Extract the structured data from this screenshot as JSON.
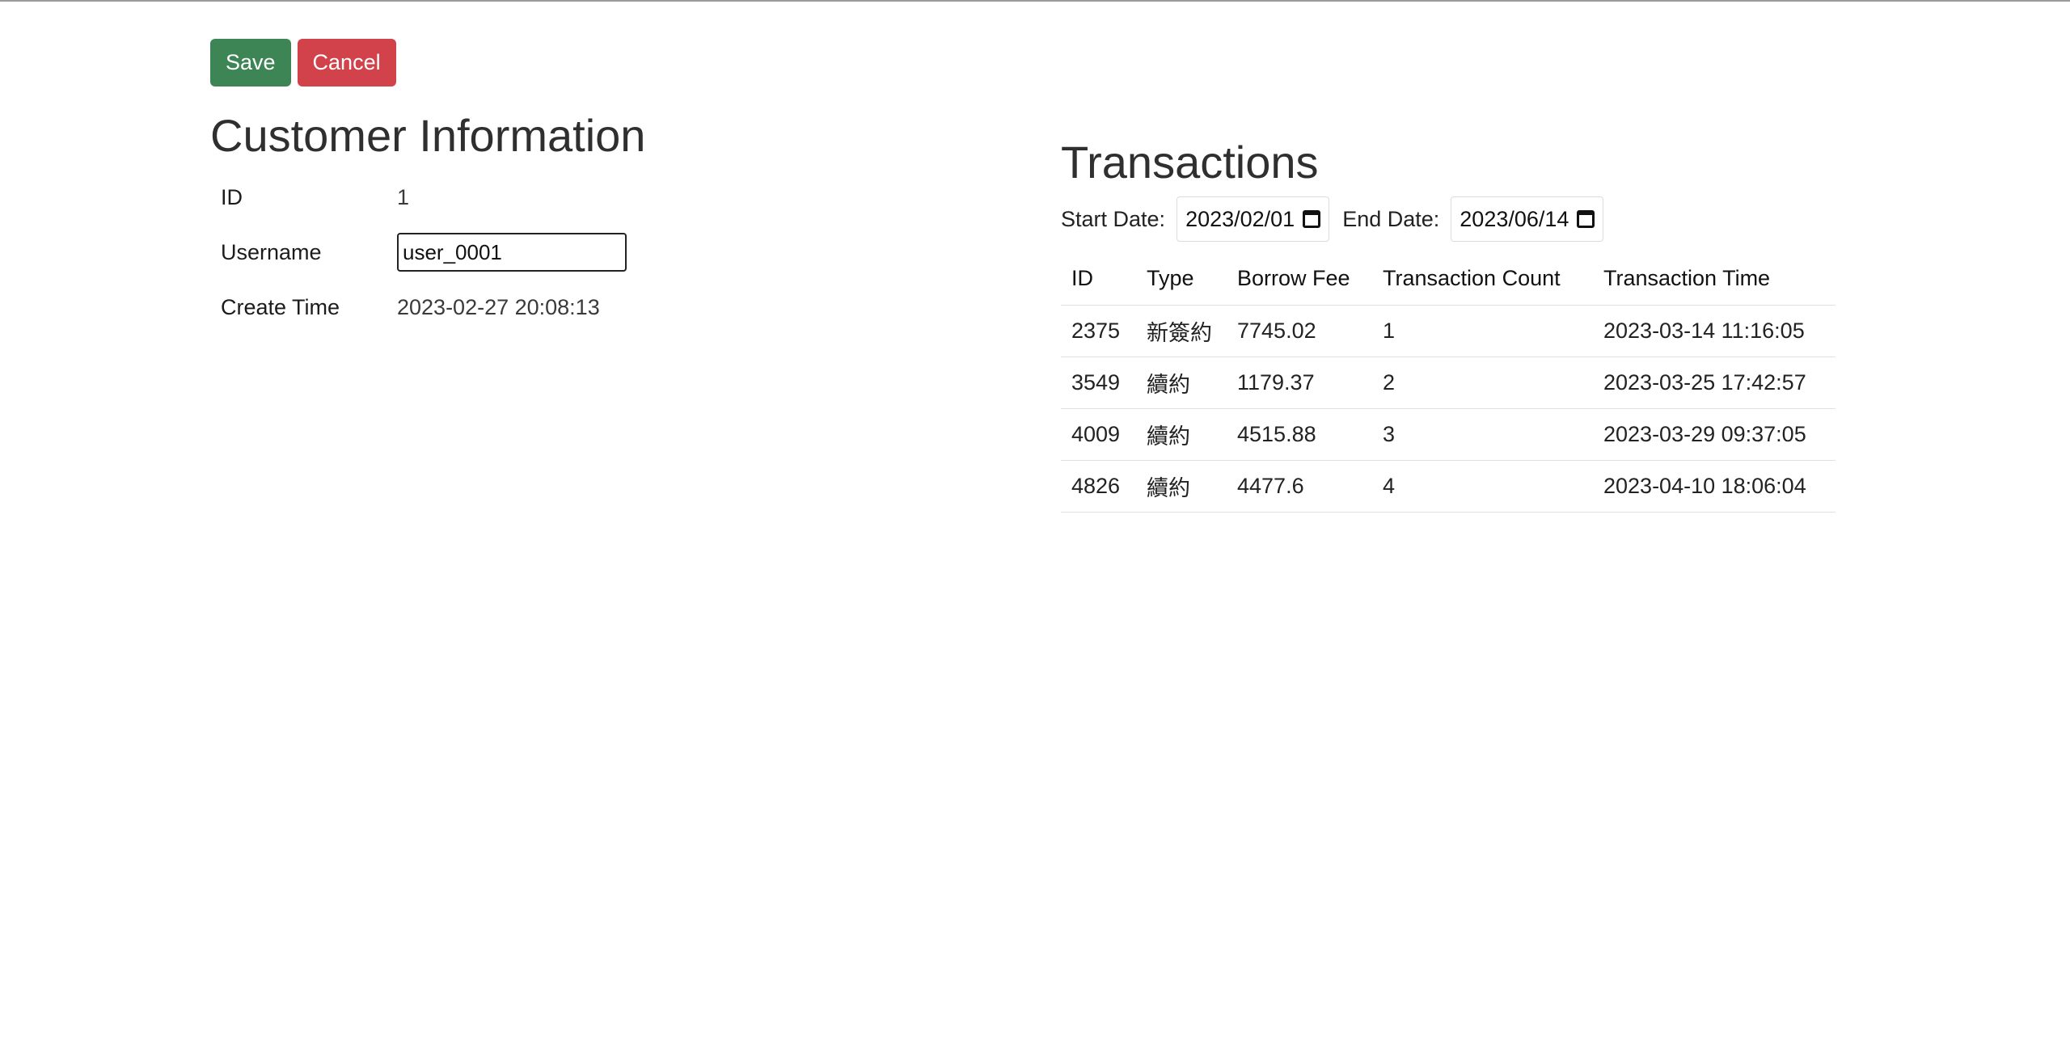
{
  "toolbar": {
    "save_label": "Save",
    "cancel_label": "Cancel",
    "save_color": "#3e8556",
    "cancel_color": "#d1424a"
  },
  "customer": {
    "title": "Customer Information",
    "fields": {
      "id_label": "ID",
      "id_value": "1",
      "username_label": "Username",
      "username_value": "user_0001",
      "create_time_label": "Create Time",
      "create_time_value": "2023-02-27 20:08:13"
    }
  },
  "transactions": {
    "title": "Transactions",
    "start_date_label": "Start Date:",
    "start_date_value": "2023/02/01",
    "end_date_label": "End Date:",
    "end_date_value": "2023/06/14",
    "calendar_icon": "calendar-icon",
    "columns": [
      "ID",
      "Type",
      "Borrow Fee",
      "Transaction Count",
      "Transaction Time"
    ],
    "rows": [
      [
        "2375",
        "新簽約",
        "7745.02",
        "1",
        "2023-03-14 11:16:05"
      ],
      [
        "3549",
        "續約",
        "1179.37",
        "2",
        "2023-03-25 17:42:57"
      ],
      [
        "4009",
        "續約",
        "4515.88",
        "3",
        "2023-03-29 09:37:05"
      ],
      [
        "4826",
        "續約",
        "4477.6",
        "4",
        "2023-04-10 18:06:04"
      ]
    ]
  }
}
